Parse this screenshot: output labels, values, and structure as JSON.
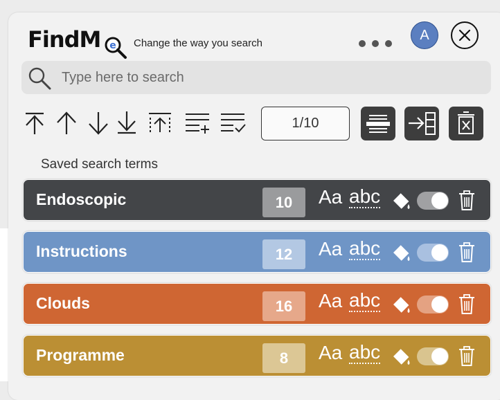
{
  "app": {
    "logo_text": "FindM",
    "logo_badge": "e",
    "tagline": "Change the way you search",
    "avatar_letter": "A"
  },
  "search": {
    "placeholder": "Type here to search"
  },
  "navigation": {
    "icons": [
      "first-match-icon",
      "previous-match-icon",
      "next-match-icon",
      "last-match-icon",
      "select-all-icon",
      "add-term-icon",
      "apply-terms-icon"
    ],
    "counter": "1/10"
  },
  "actions": [
    "highlight-view-icon",
    "sidebar-panel-icon",
    "clear-all-icon"
  ],
  "saved": {
    "label": "Saved search terms",
    "terms": [
      {
        "name": "Endoscopic",
        "count": "10",
        "color": "#434548",
        "badge_color": "#9a9b9d",
        "toggle_color": "#a0a1a3"
      },
      {
        "name": "Instructions",
        "count": "12",
        "color": "#6f95c6",
        "badge_color": "#b3c8e3",
        "toggle_color": "#a9c0e0"
      },
      {
        "name": "Clouds",
        "count": "16",
        "color": "#cf6633",
        "badge_color": "#e6a88a",
        "toggle_color": "#e4a282"
      },
      {
        "name": "Programme",
        "count": "8",
        "color": "#bb8f34",
        "badge_color": "#dcc795",
        "toggle_color": "#d9c48f"
      }
    ],
    "case_label": "Aa",
    "word_label": "abc"
  }
}
